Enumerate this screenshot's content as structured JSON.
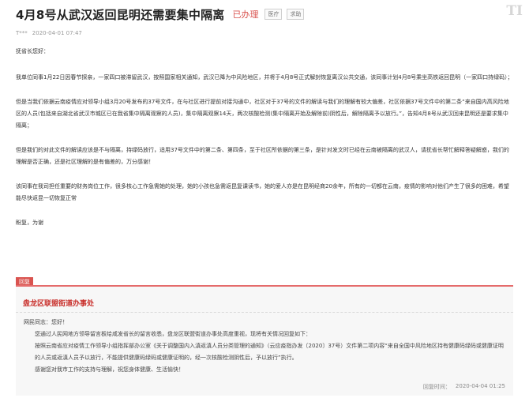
{
  "header": {
    "title": "4月8号从武汉返回昆明还需要集中隔离",
    "status": "已办理",
    "tags": [
      "医疗",
      "求助"
    ],
    "watermark": "TI"
  },
  "meta": {
    "author": "T***",
    "datetime": "2020-04-01 07:47"
  },
  "message": {
    "greeting": "抚省长您好：",
    "p1": "我单位同事1月22日因春节探亲，一家四口被滞留武汉，按照国家相关通知，武汉已降为中风险地区，并将于4月8号正式解封恢复离汉公共交通，该同事计划4月8号乘坐高铁返回昆明（一家四口持绿码）；",
    "p2": "但是当我们依据云南疫情应对领导小组3月20号发布的37号文件，在与社区进行提前对接沟通中，社区对于37号的文件的解读与我们的理解有较大偏差，社区依据37号文件中的第二条“来自国内高风险地区的人员(包括来自湖北省武汉市城区已在我省集中隔离观察的人员)，集中隔离观察14天，两次核酸检测(集中隔离开始及解除前)阴性后，解除隔离予以放行。”，告知4月8号从武汉回来昆明还是要求集中隔离；",
    "p3": "但是我们的对此文件的解读应该是不与隔离，持绿码放行，适用37号文件中的第二条、第四条，至于社区所依据的第三条，是针对发文时已经在云南被隔离的武汉人，请抚省长帮忙解释答疑解惑，我们的理解是否正确，还是社区理解的是有偏差的，万分感谢！",
    "p4": "该同事在我司担任重要的财务岗位工作，很多核心工作急需她的处理，她的小孩也急需返昆复课读书，她的爱人亦是在昆明经商20余年，所有的一切都在云南，疫情的影响对他们产生了很多的困难，希望能尽快返昆一切恢复正常",
    "closing": "盼复，为谢"
  },
  "reply": {
    "badge": "回复",
    "department": "盘龙区联盟街道办事处",
    "salutation": "网民同志：您好！",
    "line1": "您通过人民网地方领导留言板给咸发省长的留言收悉，盘龙区联盟街道办事处高度重视，现将有关情况回复如下：",
    "line2": "按照云南省应对疫情工作领导小组指挥部办公室《关于调整国内入滇返滇人员分类管理的通知》（云应疫指办发〔2020〕37号）文件第二项内容“来自全国中风险地区持有健康码绿码或健康证明的人员或返滇人员予以放行，不能提供健康码绿码或健康证明的，经一次核酸检测阴性后，予以放行”执行。",
    "line3": "感谢您对我市工作的支持与理解，祝您身体健康、生活愉快！",
    "time_label": "回复时间：",
    "time": "2020-04-04 01:25"
  }
}
